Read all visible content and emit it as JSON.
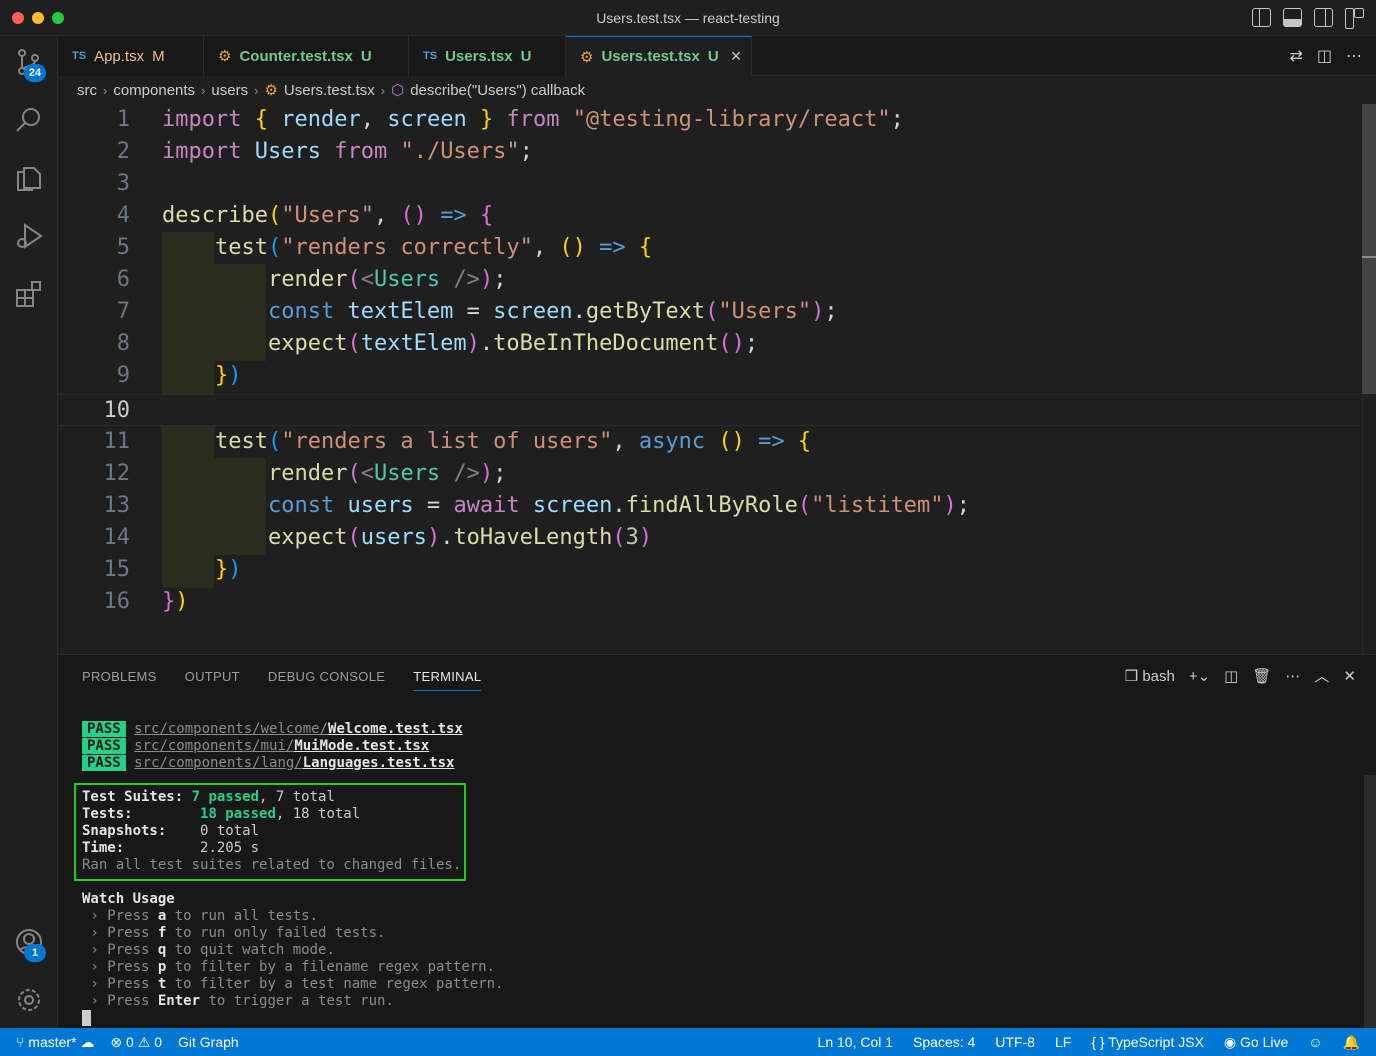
{
  "window": {
    "title": "Users.test.tsx — react-testing"
  },
  "activity": {
    "scm_badge": "24",
    "accounts_badge": "1"
  },
  "tabs": [
    {
      "type": "TS",
      "name": "App.tsx",
      "status": "M"
    },
    {
      "type": "gear",
      "name": "Counter.test.tsx",
      "status": "U"
    },
    {
      "type": "TS",
      "name": "Users.tsx",
      "status": "U"
    },
    {
      "type": "gear",
      "name": "Users.test.tsx",
      "status": "U"
    }
  ],
  "breadcrumb": [
    "src",
    "components",
    "users",
    "Users.test.tsx",
    "describe(\"Users\") callback"
  ],
  "editor": {
    "line_numbers": [
      "1",
      "2",
      "3",
      "4",
      "5",
      "6",
      "7",
      "8",
      "9",
      "10",
      "11",
      "12",
      "13",
      "14",
      "15",
      "16"
    ],
    "current_line": "10",
    "strings": {
      "s1": "\"@testing-library/react\"",
      "s2": "\"./Users\"",
      "s3": "\"Users\"",
      "s4": "\"renders correctly\"",
      "s5": "\"Users\"",
      "s6": "\"renders a list of users\"",
      "s7": "\"listitem\"",
      "n1": "3"
    }
  },
  "panel": {
    "tabs": [
      "PROBLEMS",
      "OUTPUT",
      "DEBUG CONSOLE",
      "TERMINAL"
    ],
    "active_tab": "TERMINAL",
    "shell": "bash",
    "terminal": {
      "pass_label": "PASS",
      "files": [
        {
          "dir": "src/components/welcome/",
          "file": "Welcome.test.tsx"
        },
        {
          "dir": "src/components/mui/",
          "file": "MuiMode.test.tsx"
        },
        {
          "dir": "src/components/lang/",
          "file": "Languages.test.tsx"
        }
      ],
      "summary": {
        "suites_label": "Test Suites:",
        "suites_passed": "7 passed",
        "suites_total": ", 7 total",
        "tests_label": "Tests:",
        "tests_passed": "18 passed",
        "tests_total": ", 18 total",
        "snapshots_label": "Snapshots:",
        "snapshots_value": "0 total",
        "time_label": "Time:",
        "time_value": "2.205 s",
        "ran_text": "Ran all test suites related to changed files."
      },
      "watch_title": "Watch Usage",
      "watch_items": [
        {
          "key": "a",
          "text": " to run all tests."
        },
        {
          "key": "f",
          "text": " to run only failed tests."
        },
        {
          "key": "q",
          "text": " to quit watch mode."
        },
        {
          "key": "p",
          "text": " to filter by a filename regex pattern."
        },
        {
          "key": "t",
          "text": " to filter by a test name regex pattern."
        },
        {
          "key": "Enter",
          "text": " to trigger a test run."
        }
      ],
      "press_label": "Press "
    }
  },
  "status": {
    "branch": "master*",
    "errors": "0",
    "warnings": "0",
    "git_graph": "Git Graph",
    "position": "Ln 10, Col 1",
    "spaces": "Spaces: 4",
    "encoding": "UTF-8",
    "eol": "LF",
    "language": "TypeScript JSX",
    "go_live": "Go Live"
  },
  "colors": {
    "accent": "#0078d4",
    "pass": "#23d18b",
    "summary_box": "#22cc22"
  }
}
